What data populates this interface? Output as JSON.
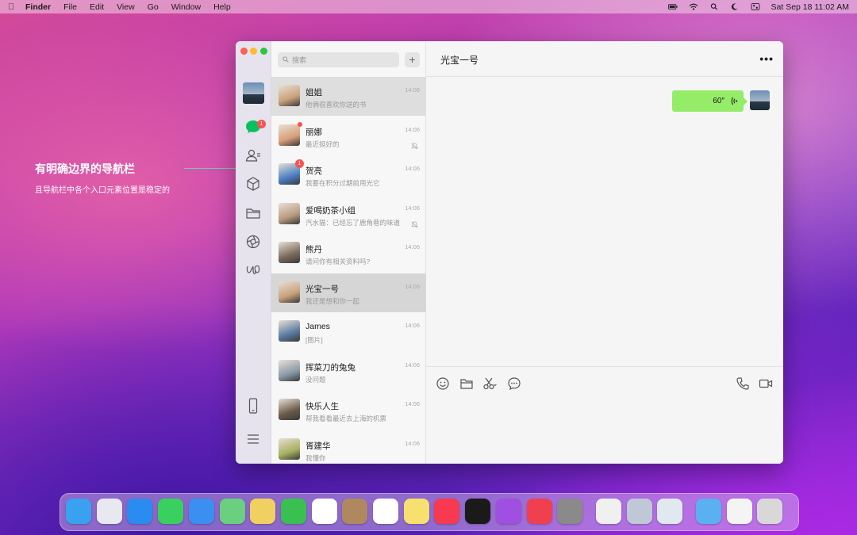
{
  "menubar": {
    "app_name": "Finder",
    "items": [
      "File",
      "Edit",
      "View",
      "Go",
      "Window",
      "Help"
    ],
    "datetime": "Sat Sep 18  11:02 AM"
  },
  "annotation": {
    "title": "有明确边界的导航栏",
    "subtitle": "且导航栏中各个入口元素位置是稳定的"
  },
  "nav": {
    "chat_badge": "1",
    "icons": [
      "chat-icon",
      "contacts-icon",
      "cube-icon",
      "folder-icon",
      "aperture-icon",
      "mini-program-icon",
      "phone-icon",
      "menu-icon"
    ]
  },
  "search": {
    "placeholder": "搜索",
    "add_label": "+"
  },
  "conversations": [
    {
      "name": "姐姐",
      "message": "他俩很喜欢你送的书",
      "time": "14:06",
      "muted": false,
      "badge": "",
      "color": "#c9a27c"
    },
    {
      "name": "丽娜",
      "message": "最近挺好的",
      "time": "14:06",
      "muted": true,
      "badge": "",
      "dot": true,
      "color": "#d9a07a"
    },
    {
      "name": "贺亮",
      "message": "我要在积分过期前用光它",
      "time": "14:06",
      "muted": false,
      "badge": "1",
      "color": "#4a7ec2"
    },
    {
      "name": "爱喝奶茶小组",
      "message": "汽水猫：已经忘了鹿角巷的味道",
      "time": "14:06",
      "muted": true,
      "badge": "",
      "color": "#b89a80"
    },
    {
      "name": "熊丹",
      "message": "请问你有相关资料吗?",
      "time": "14:06",
      "muted": false,
      "badge": "",
      "color": "#7a6a5c"
    },
    {
      "name": "光宝一号",
      "message": "我还是想和你一起",
      "time": "14:06",
      "muted": false,
      "badge": "",
      "color": "#c8a07c"
    },
    {
      "name": "James",
      "message": "[图片]",
      "time": "14:06",
      "muted": false,
      "badge": "",
      "color": "#5a7aa0"
    },
    {
      "name": "挥菜刀的兔兔",
      "message": "没问题",
      "time": "14:06",
      "muted": false,
      "badge": "",
      "color": "#8a9aa8"
    },
    {
      "name": "快乐人生",
      "message": "帮我看看最近去上海的机票",
      "time": "14:06",
      "muted": false,
      "badge": "",
      "color": "#6a5a4a"
    },
    {
      "name": "胥建华",
      "message": "我懂你",
      "time": "14:06",
      "muted": false,
      "badge": "",
      "color": "#a8b060"
    }
  ],
  "chat": {
    "title": "光宝一号",
    "more": "•••",
    "voice_duration": "60″"
  }
}
